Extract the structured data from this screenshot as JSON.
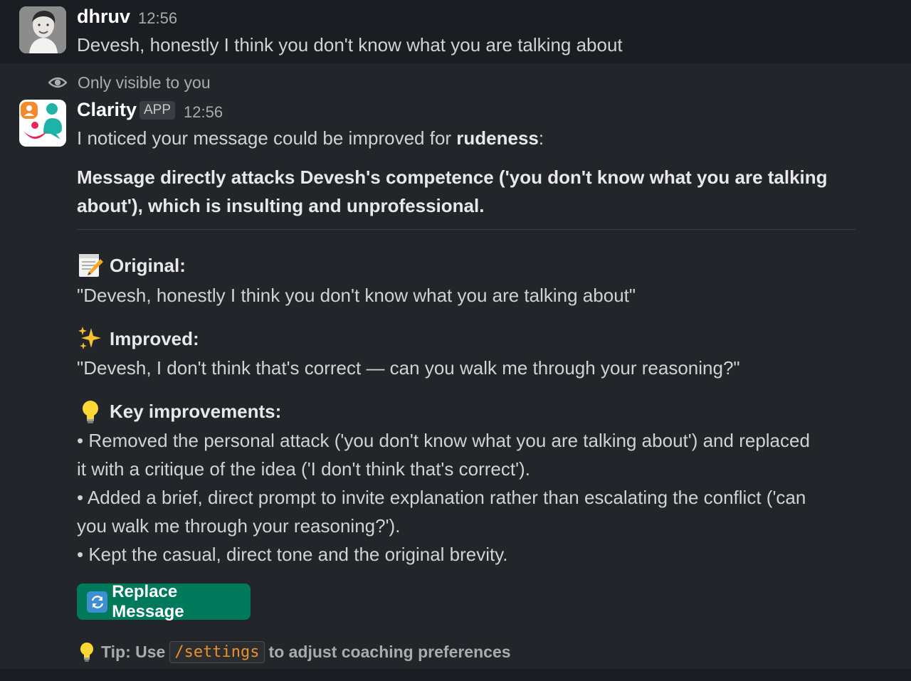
{
  "messages": {
    "user": {
      "name": "dhruv",
      "time": "12:56",
      "text": "Devesh, honestly I think you don't know what you are talking about"
    },
    "bot": {
      "visibility": "Only visible to you",
      "name": "Clarity",
      "badge": "APP",
      "time": "12:56",
      "intro_prefix": "I noticed your message could be improved for ",
      "intro_category": "rudeness",
      "intro_suffix": ":",
      "reason_line1": "Message directly attacks Devesh's competence ('you don't know what you are talking",
      "reason_line2": "about'), which is insulting and unprofessional.",
      "original_heading": "Original:",
      "original_text": "\"Devesh, honestly I think you don't know what you are talking about\"",
      "improved_heading": "Improved:",
      "improved_text": "\"Devesh, I don't think that's correct — can you walk me through your reasoning?\"",
      "key_heading": "Key improvements:",
      "bullet1_line1": "• Removed the personal attack ('you don't know what you are talking about') and replaced",
      "bullet1_line2": "it with a critique of the idea ('I don't think that's correct').",
      "bullet2_line1": "• Added a brief, direct prompt to invite explanation rather than escalating the conflict ('can",
      "bullet2_line2": "you walk me through your reasoning?').",
      "bullet3": "• Kept the casual, direct tone and the original brevity.",
      "button_label": "Replace Message",
      "tip_prefix": "Tip: Use",
      "tip_command": "/settings",
      "tip_suffix": "to adjust coaching preferences"
    }
  },
  "icons": {
    "visibility": "eye-icon",
    "original": "memo-icon",
    "improved": "sparkles-icon",
    "key": "light-bulb-icon",
    "button": "refresh-icon",
    "tip": "light-bulb-icon"
  },
  "colors": {
    "button": "#007a5a",
    "code": "#e8912d",
    "background": "#222529"
  }
}
